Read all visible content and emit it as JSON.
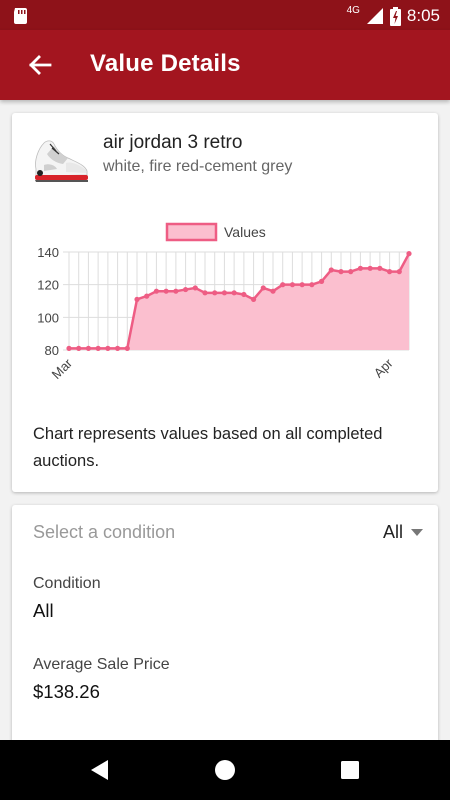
{
  "status_bar": {
    "network": "4G",
    "time": "8:05"
  },
  "app_bar": {
    "title": "Value Details",
    "back_icon": "arrow-back-icon"
  },
  "product": {
    "name": "air jordan 3 retro",
    "colorway": "white, fire red-cement grey"
  },
  "chart_data": {
    "type": "line",
    "legend": [
      "Values"
    ],
    "series": [
      {
        "name": "Values",
        "values": [
          81,
          81,
          81,
          81,
          81,
          81,
          81,
          111,
          113,
          116,
          116,
          116,
          117,
          118,
          115,
          115,
          115,
          115,
          114,
          111,
          118,
          116,
          120,
          120,
          120,
          120,
          122,
          129,
          128,
          128,
          130,
          130,
          130,
          128,
          128,
          139
        ]
      }
    ],
    "x_tick_labels": [
      {
        "label": "Mar",
        "index": 0
      },
      {
        "label": "Apr",
        "index": 33
      }
    ],
    "y_ticks": [
      80,
      100,
      120,
      140
    ],
    "ylim": [
      80,
      140
    ],
    "area_fill": true,
    "grid": true,
    "legend_position": "top",
    "colors": {
      "line": "#ee5d84",
      "fill": "#fbbfcf",
      "grid": "#dddddd"
    }
  },
  "chart_note": "Chart represents values based on all completed auctions.",
  "condition_filter": {
    "placeholder": "Select a condition",
    "selected": "All"
  },
  "details": {
    "condition_label": "Condition",
    "condition_value": "All",
    "avg_price_label": "Average Sale Price",
    "avg_price_value": "$138.26"
  },
  "colors": {
    "status_bar": "#8e1219",
    "app_bar": "#a3151f",
    "accent_line": "#ee5d84",
    "accent_fill": "#fbbfcf"
  }
}
